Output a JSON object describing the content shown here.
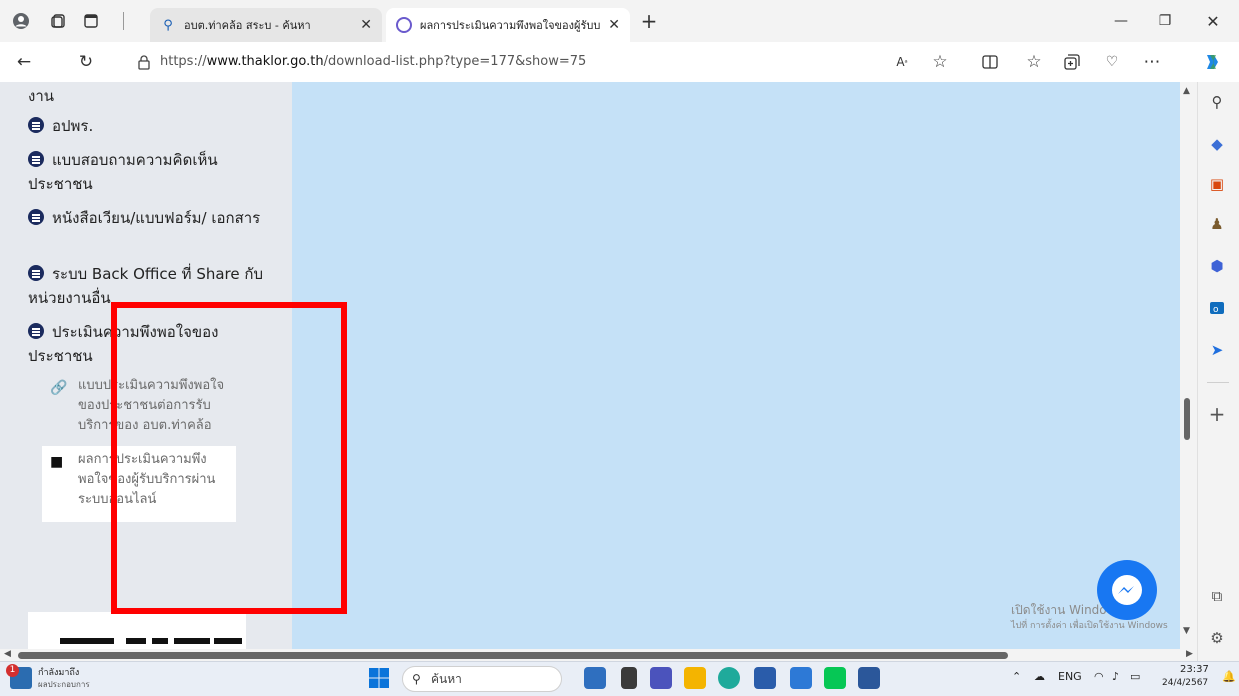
{
  "browser": {
    "profile_icon": "profile-icon",
    "tabs": [
      {
        "title": "อบต.ท่าคล้อ สระบ - ค้นหา",
        "active": false,
        "icon": "search-icon"
      },
      {
        "title": "ผลการประเมินความพึงพอใจของผู้รับบ",
        "active": true,
        "icon": "site-favicon"
      }
    ],
    "new_tab_label": "+",
    "window_controls": {
      "minimize": "—",
      "restore": "❐",
      "close": "✕"
    },
    "url_prefix": "https://",
    "url_domain": "www.thaklor.go.th",
    "url_path": "/download-list.php?type=177&show=75"
  },
  "sidebar": {
    "top_fragment": "งาน",
    "items": [
      {
        "label": "อปพร."
      },
      {
        "label": "แบบสอบถามความคิดเห็น ประชาชน"
      },
      {
        "label": "หนังสือเวียน/แบบฟอร์ม/ เอกสาร"
      },
      {
        "label": "ระบบ Back Office ที่ Share กับหน่วยงานอื่น"
      },
      {
        "label": "ประเมินความพึงพอใจของ ประชาชน"
      }
    ],
    "sub_items": [
      {
        "label": "แบบประเมินความพึงพอใจของประชาชนต่อการรับบริการของ อบต.ท่าคล้อ",
        "icon": "link-icon"
      },
      {
        "label": "ผลการประเมินความพึงพอใจของผู้รับบริการผ่านระบบออนไลน์",
        "icon": "folder-icon"
      }
    ]
  },
  "watermark": {
    "line1": "เปิดใช้งาน Windows",
    "line2": "ไปที่ การตั้งค่า เพื่อเปิดใช้งาน Windows"
  },
  "taskbar": {
    "notify_badge": "1",
    "widget_line1": "กำลังมาถึง",
    "widget_line2": "ผลประกอบการ",
    "search_placeholder": "ค้นหา",
    "lang": "ENG",
    "time": "23:37",
    "date": "24/4/2567"
  },
  "colors": {
    "content_area": "#c5e1f7",
    "sidebar_bg": "#e6e9ee",
    "highlight_box": "#ff0000",
    "bullet": "#1b2b5e",
    "messenger": "#1877f2"
  }
}
